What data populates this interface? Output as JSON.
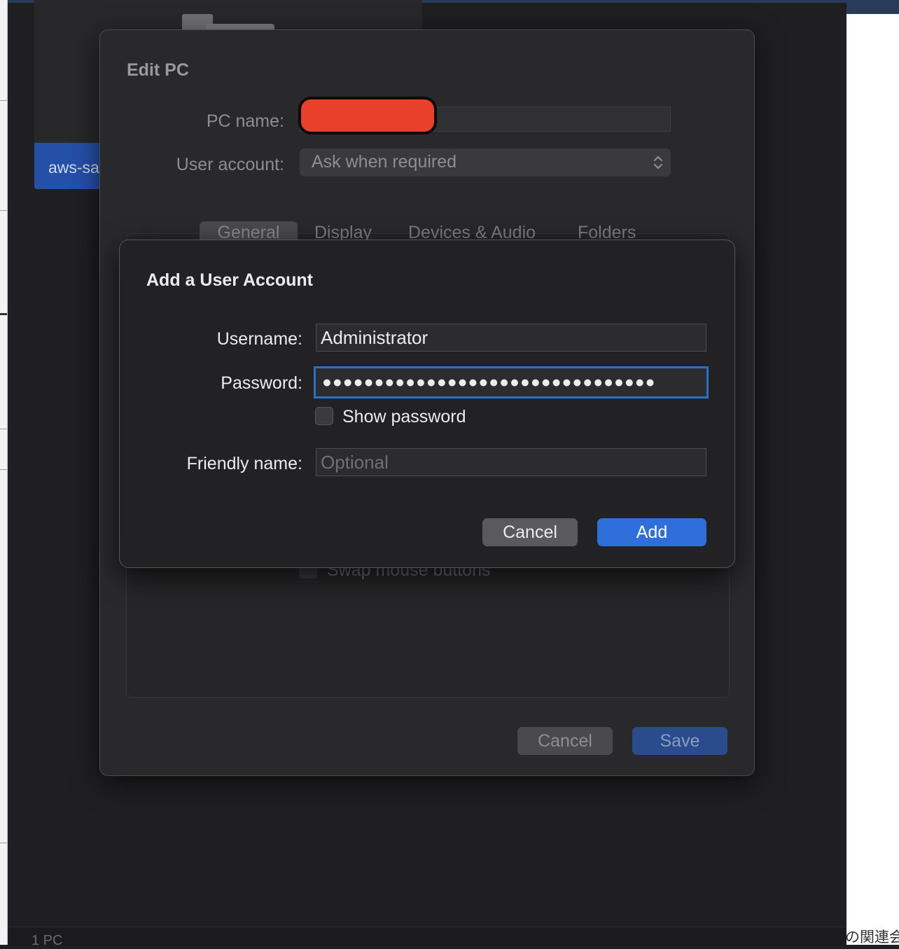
{
  "background": {
    "pc_item_label": "aws-sa",
    "status_bar": "1 PC",
    "right_window_text": "の関連会"
  },
  "edit_pc": {
    "title": "Edit PC",
    "pc_name_label": "PC name:",
    "user_account_label": "User account:",
    "user_account_value": "Ask when required",
    "tabs": [
      "General",
      "Display",
      "Devices & Audio",
      "Folders"
    ],
    "swap_mouse_label": "Swap mouse buttons",
    "cancel_label": "Cancel",
    "save_label": "Save"
  },
  "add_account": {
    "title": "Add a User Account",
    "username_label": "Username:",
    "username_value": "Administrator",
    "password_label": "Password:",
    "password_value": "●●●●●●●●●●●●●●●●●●●●●●●●●●●●●●●●",
    "show_password_label": "Show password",
    "friendly_label": "Friendly name:",
    "friendly_placeholder": "Optional",
    "cancel_label": "Cancel",
    "add_label": "Add"
  },
  "colors": {
    "accent": "#2f6fdb",
    "focus_ring": "#2d6ec7",
    "redaction": "#e8402a"
  },
  "icons": {
    "select_chevron": "chevron-up-down-icon",
    "folder": "folder-icon"
  }
}
